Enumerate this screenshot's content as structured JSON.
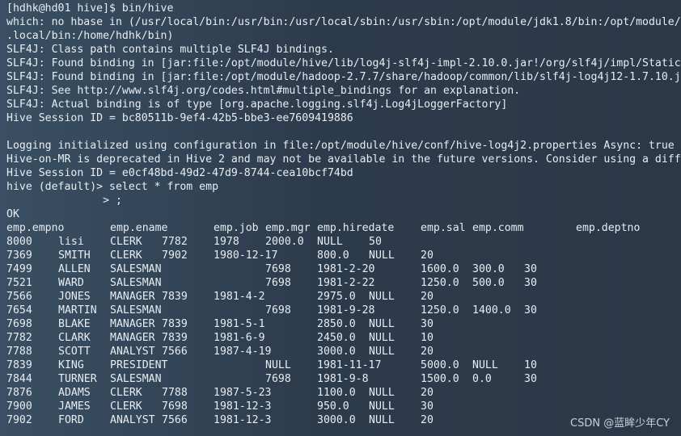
{
  "log_lines": [
    "[hdhk@hd01 hive]$ bin/hive",
    "which: no hbase in (/usr/local/bin:/usr/bin:/usr/local/sbin:/usr/sbin:/opt/module/jdk1.8/bin:/opt/module/",
    ".local/bin:/home/hdhk/bin)",
    "SLF4J: Class path contains multiple SLF4J bindings.",
    "SLF4J: Found binding in [jar:file:/opt/module/hive/lib/log4j-slf4j-impl-2.10.0.jar!/org/slf4j/impl/Static",
    "SLF4J: Found binding in [jar:file:/opt/module/hadoop-2.7.7/share/hadoop/common/lib/slf4j-log4j12-1.7.10.j",
    "SLF4J: See http://www.slf4j.org/codes.html#multiple_bindings for an explanation.",
    "SLF4J: Actual binding is of type [org.apache.logging.slf4j.Log4jLoggerFactory]",
    "Hive Session ID = bc80511b-9ef4-42b5-bbe3-ee7609419886",
    "",
    "Logging initialized using configuration in file:/opt/module/hive/conf/hive-log4j2.properties Async: true",
    "Hive-on-MR is deprecated in Hive 2 and may not be available in the future versions. Consider using a diff",
    "Hive Session ID = e0cf48bd-49d2-47d9-8744-cea10bcf74bd",
    "hive (default)> select * from emp",
    "               > ;",
    "OK"
  ],
  "result_header": [
    "emp.empno",
    "emp.ename",
    "emp.job",
    "emp.mgr",
    "emp.hiredate",
    "emp.sal",
    "emp.comm",
    "emp.deptno"
  ],
  "result_rows": [
    [
      "8000",
      "lisi",
      "CLERK",
      "7782",
      "1978",
      "2000.0",
      "NULL",
      "50"
    ],
    [
      "7369",
      "SMITH",
      "CLERK",
      "7902",
      "1980-12-17",
      "800.0",
      "NULL",
      "20"
    ],
    [
      "7499",
      "ALLEN",
      "SALESMAN",
      "",
      "7698",
      "1981-2-20",
      "1600.0",
      "300.0",
      "30"
    ],
    [
      "7521",
      "WARD",
      "SALESMAN",
      "",
      "7698",
      "1981-2-22",
      "1250.0",
      "500.0",
      "30"
    ],
    [
      "7566",
      "JONES",
      "MANAGER",
      "7839",
      "1981-4-2",
      "2975.0",
      "NULL",
      "20"
    ],
    [
      "7654",
      "MARTIN",
      "SALESMAN",
      "",
      "7698",
      "1981-9-28",
      "1250.0",
      "1400.0",
      "30"
    ],
    [
      "7698",
      "BLAKE",
      "MANAGER",
      "7839",
      "1981-5-1",
      "2850.0",
      "NULL",
      "30"
    ],
    [
      "7782",
      "CLARK",
      "MANAGER",
      "7839",
      "1981-6-9",
      "2450.0",
      "NULL",
      "10"
    ],
    [
      "7788",
      "SCOTT",
      "ANALYST",
      "7566",
      "1987-4-19",
      "3000.0",
      "NULL",
      "20"
    ],
    [
      "7839",
      "KING",
      "PRESIDENT",
      "",
      "NULL",
      "1981-11-17",
      "5000.0",
      "NULL",
      "10"
    ],
    [
      "7844",
      "TURNER",
      "SALESMAN",
      "",
      "7698",
      "1981-9-8",
      "1500.0",
      "0.0",
      "30"
    ],
    [
      "7876",
      "ADAMS",
      "CLERK",
      "7788",
      "1987-5-23",
      "1100.0",
      "NULL",
      "20"
    ],
    [
      "7900",
      "JAMES",
      "CLERK",
      "7698",
      "1981-12-3",
      "950.0",
      "NULL",
      "30"
    ],
    [
      "7902",
      "FORD",
      "ANALYST",
      "7566",
      "1981-12-3",
      "3000.0",
      "NULL",
      "20"
    ]
  ],
  "watermark": "CSDN @蓝眸少年CY"
}
